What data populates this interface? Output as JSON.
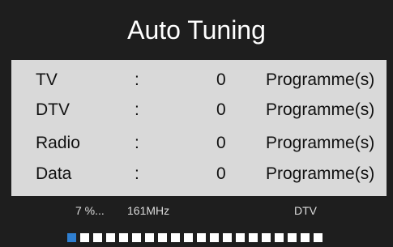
{
  "title": "Auto Tuning",
  "rows": [
    {
      "name": "TV",
      "sep": ":",
      "count": "0",
      "unit": "Programme(s)"
    },
    {
      "name": "DTV",
      "sep": ":",
      "count": "0",
      "unit": "Programme(s)"
    },
    {
      "name": "Radio",
      "sep": ":",
      "count": "0",
      "unit": "Programme(s)"
    },
    {
      "name": "Data",
      "sep": ":",
      "count": "0",
      "unit": "Programme(s)"
    }
  ],
  "status": {
    "percent": "7 %...",
    "frequency": "161MHz",
    "type": "DTV"
  },
  "progress": {
    "completed_segments": 1,
    "total_segments": 20
  },
  "colors": {
    "background": "#1e1e1e",
    "list_background": "#d9d9d9",
    "progress_done": "#2f7fd1",
    "progress_pending": "#ffffff"
  }
}
